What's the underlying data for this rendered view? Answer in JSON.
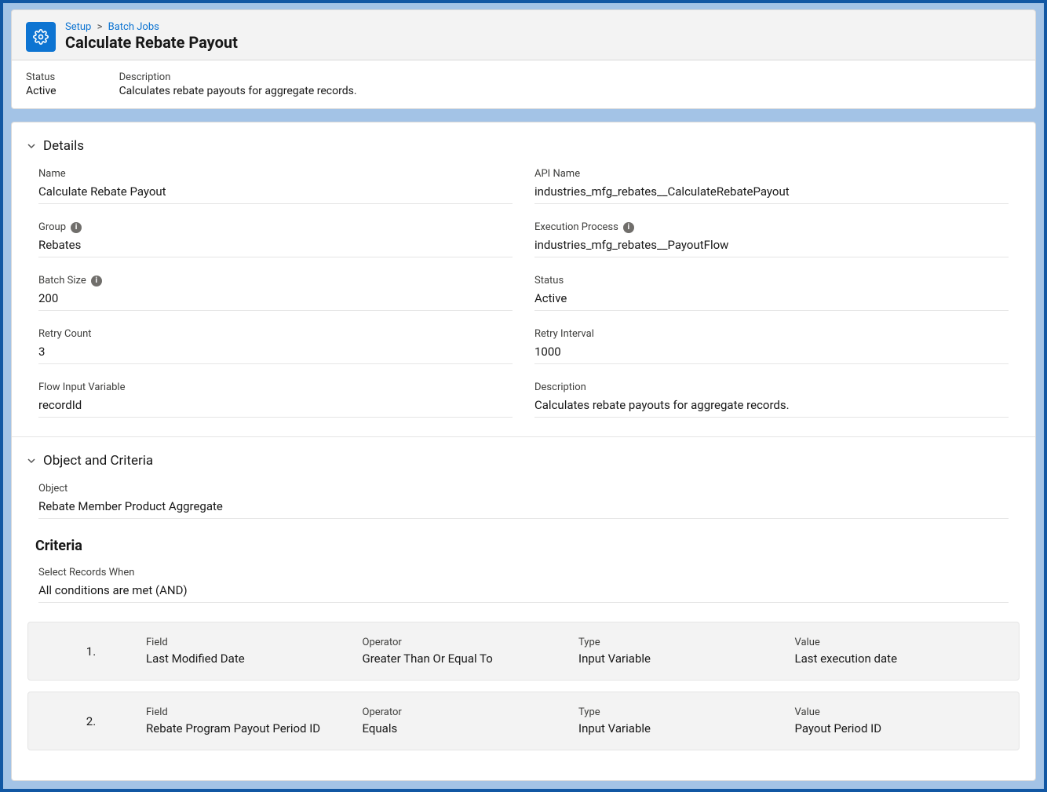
{
  "breadcrumb": {
    "setup": "Setup",
    "batch_jobs": "Batch Jobs"
  },
  "page_title": "Calculate Rebate Payout",
  "summary": {
    "status_label": "Status",
    "status_value": "Active",
    "description_label": "Description",
    "description_value": "Calculates rebate payouts for aggregate records."
  },
  "sections": {
    "details": {
      "title": "Details",
      "fields": {
        "name_label": "Name",
        "name_value": "Calculate Rebate Payout",
        "api_name_label": "API Name",
        "api_name_value": "industries_mfg_rebates__CalculateRebatePayout",
        "group_label": "Group",
        "group_value": "Rebates",
        "execution_process_label": "Execution Process",
        "execution_process_value": "industries_mfg_rebates__PayoutFlow",
        "batch_size_label": "Batch Size",
        "batch_size_value": "200",
        "status_label": "Status",
        "status_value": "Active",
        "retry_count_label": "Retry Count",
        "retry_count_value": "3",
        "retry_interval_label": "Retry Interval",
        "retry_interval_value": "1000",
        "flow_input_var_label": "Flow Input Variable",
        "flow_input_var_value": "recordId",
        "description_label": "Description",
        "description_value": "Calculates rebate payouts for aggregate records."
      }
    },
    "object_and_criteria": {
      "title": "Object and Criteria",
      "object_label": "Object",
      "object_value": "Rebate Member Product Aggregate",
      "criteria_title": "Criteria",
      "select_when_label": "Select Records When",
      "select_when_value": "All conditions are met (AND)",
      "rows": [
        {
          "num": "1.",
          "field_label": "Field",
          "field_value": "Last Modified Date",
          "operator_label": "Operator",
          "operator_value": "Greater Than Or Equal To",
          "type_label": "Type",
          "type_value": "Input Variable",
          "value_label": "Value",
          "value_value": "Last execution date"
        },
        {
          "num": "2.",
          "field_label": "Field",
          "field_value": "Rebate Program Payout Period ID",
          "operator_label": "Operator",
          "operator_value": "Equals",
          "type_label": "Type",
          "type_value": "Input Variable",
          "value_label": "Value",
          "value_value": "Payout Period ID"
        }
      ]
    }
  }
}
